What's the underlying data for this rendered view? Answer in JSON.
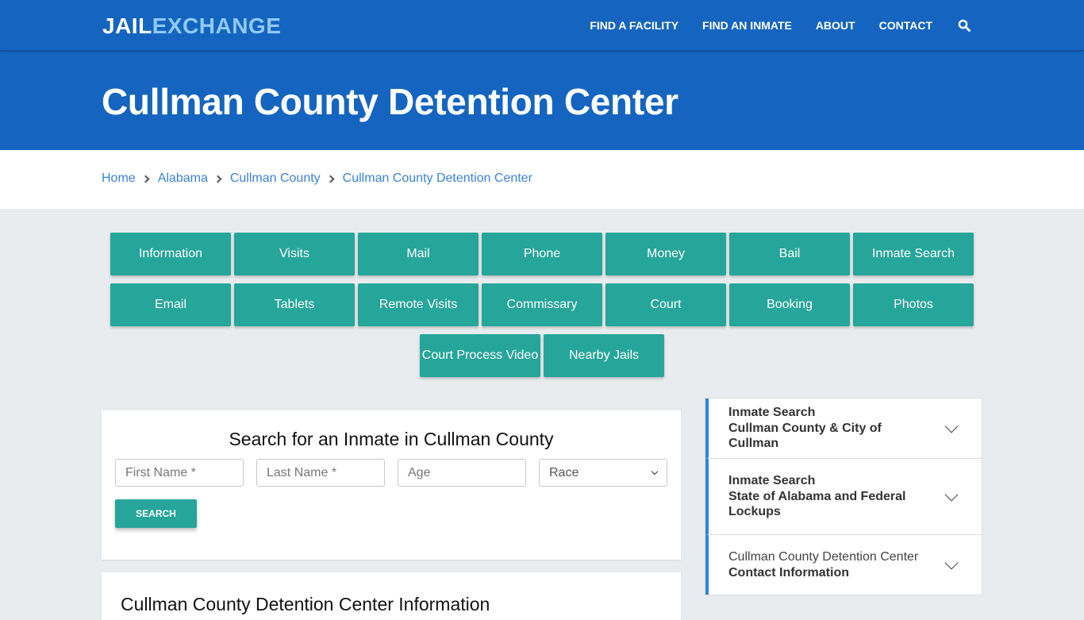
{
  "header": {
    "logo_part1": "JAIL",
    "logo_part2": "EXCHANGE",
    "nav": [
      {
        "label": "FIND A FACILITY"
      },
      {
        "label": "FIND AN INMATE"
      },
      {
        "label": "ABOUT"
      },
      {
        "label": "CONTACT"
      }
    ],
    "search_icon": "search-icon"
  },
  "hero": {
    "title": "Cullman County Detention Center"
  },
  "breadcrumb": [
    {
      "label": "Home"
    },
    {
      "label": "Alabama"
    },
    {
      "label": "Cullman County"
    },
    {
      "label": "Cullman County Detention Center"
    }
  ],
  "tiles": [
    {
      "label": "Information"
    },
    {
      "label": "Visits"
    },
    {
      "label": "Mail"
    },
    {
      "label": "Phone"
    },
    {
      "label": "Money"
    },
    {
      "label": "Bail"
    },
    {
      "label": "Inmate Search"
    },
    {
      "label": "Email"
    },
    {
      "label": "Tablets"
    },
    {
      "label": "Remote Visits"
    },
    {
      "label": "Commissary"
    },
    {
      "label": "Court"
    },
    {
      "label": "Booking"
    },
    {
      "label": "Photos"
    },
    {
      "label": "Court Process Video"
    },
    {
      "label": "Nearby Jails"
    }
  ],
  "search": {
    "title": "Search for an Inmate in Cullman County",
    "first_name_placeholder": "First Name *",
    "last_name_placeholder": "Last Name *",
    "age_placeholder": "Age",
    "race_selected": "Race",
    "button_label": "SEARCH"
  },
  "info": {
    "title": "Cullman County Detention Center Information"
  },
  "sidebar": {
    "items": [
      {
        "line1": "Inmate Search",
        "line2": "Cullman County & City of Cullman"
      },
      {
        "line1": "Inmate Search",
        "line2": "State of Alabama and Federal Lockups"
      },
      {
        "line1": "Cullman County Detention Center",
        "line2": "Contact Information"
      }
    ]
  },
  "colors": {
    "brand_blue": "#1565c0",
    "logo_light_blue": "#90caf9",
    "teal": "#26a69a",
    "link_blue": "#3a83d1",
    "accent_border": "#2f86d6",
    "page_bg": "#e9ecef"
  }
}
